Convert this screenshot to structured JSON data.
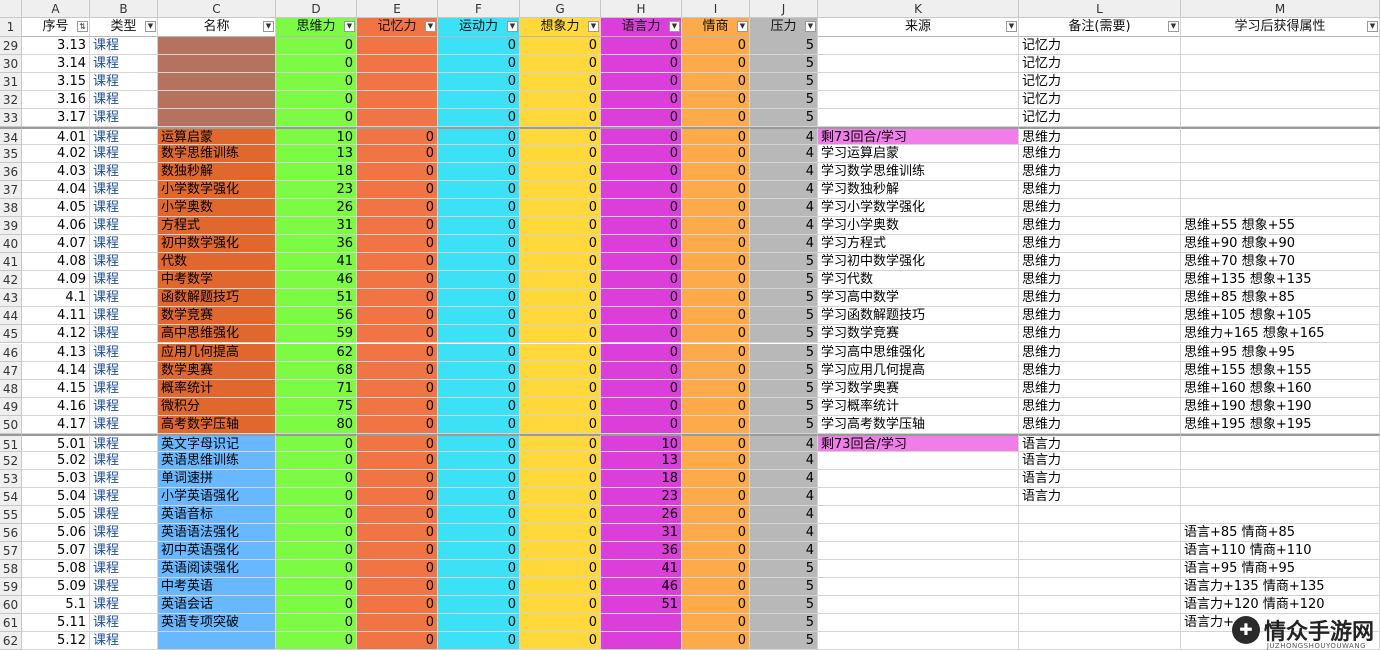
{
  "colors": {
    "name_brown": "#b5735f",
    "name_orange": "#e0682f",
    "name_blue": "#67b8ff",
    "d_green": "#7dfb44",
    "e_orange": "#f07444",
    "f_cyan": "#3de1f5",
    "g_yellow": "#ffd93b",
    "h_magenta": "#dc3fd9",
    "i_orange": "#fdaa4a",
    "j_gray": "#b8b8b8",
    "k_pink": "#f07de8",
    "white": "#ffffff"
  },
  "column_letters": [
    "",
    "A",
    "B",
    "C",
    "D",
    "E",
    "F",
    "G",
    "H",
    "I",
    "J",
    "K",
    "L",
    "M"
  ],
  "headers": [
    "1",
    "序号",
    "类型",
    "名称",
    "思维力",
    "记忆力",
    "运动力",
    "想象力",
    "语言力",
    "情商",
    "压力",
    "来源",
    "备注(需要)",
    "学习后获得属性"
  ],
  "rows": [
    {
      "rn": "29",
      "a": "3.13",
      "b": "课程",
      "c": "",
      "d": "0",
      "e": "",
      "f": "0",
      "g": "0",
      "h": "0",
      "i": "0",
      "j": "5",
      "k": "",
      "l": "记忆力",
      "m": ""
    },
    {
      "rn": "30",
      "a": "3.14",
      "b": "课程",
      "c": "",
      "d": "0",
      "e": "",
      "f": "0",
      "g": "0",
      "h": "0",
      "i": "0",
      "j": "5",
      "k": "",
      "l": "记忆力",
      "m": ""
    },
    {
      "rn": "31",
      "a": "3.15",
      "b": "课程",
      "c": "",
      "d": "0",
      "e": "",
      "f": "0",
      "g": "0",
      "h": "0",
      "i": "0",
      "j": "5",
      "k": "",
      "l": "记忆力",
      "m": ""
    },
    {
      "rn": "32",
      "a": "3.16",
      "b": "课程",
      "c": "",
      "d": "0",
      "e": "",
      "f": "0",
      "g": "0",
      "h": "0",
      "i": "0",
      "j": "5",
      "k": "",
      "l": "记忆力",
      "m": ""
    },
    {
      "rn": "33",
      "a": "3.17",
      "b": "课程",
      "c": "",
      "d": "0",
      "e": "",
      "f": "0",
      "g": "0",
      "h": "0",
      "i": "0",
      "j": "5",
      "k": "",
      "l": "记忆力",
      "m": ""
    },
    {
      "rn": "34",
      "a": "4.01",
      "b": "课程",
      "c": "运算启蒙",
      "d": "10",
      "e": "0",
      "f": "0",
      "g": "0",
      "h": "0",
      "i": "0",
      "j": "4",
      "k": "剩73回合/学习",
      "l": "思维力",
      "m": ""
    },
    {
      "rn": "35",
      "a": "4.02",
      "b": "课程",
      "c": "数学思维训练",
      "d": "13",
      "e": "0",
      "f": "0",
      "g": "0",
      "h": "0",
      "i": "0",
      "j": "4",
      "k": "学习运算启蒙",
      "l": "思维力",
      "m": ""
    },
    {
      "rn": "36",
      "a": "4.03",
      "b": "课程",
      "c": "数独秒解",
      "d": "18",
      "e": "0",
      "f": "0",
      "g": "0",
      "h": "0",
      "i": "0",
      "j": "4",
      "k": "学习数学思维训练",
      "l": "思维力",
      "m": ""
    },
    {
      "rn": "37",
      "a": "4.04",
      "b": "课程",
      "c": "小学数学强化",
      "d": "23",
      "e": "0",
      "f": "0",
      "g": "0",
      "h": "0",
      "i": "0",
      "j": "4",
      "k": "学习数独秒解",
      "l": "思维力",
      "m": ""
    },
    {
      "rn": "38",
      "a": "4.05",
      "b": "课程",
      "c": "小学奥数",
      "d": "26",
      "e": "0",
      "f": "0",
      "g": "0",
      "h": "0",
      "i": "0",
      "j": "4",
      "k": "学习小学数学强化",
      "l": "思维力",
      "m": ""
    },
    {
      "rn": "39",
      "a": "4.06",
      "b": "课程",
      "c": "方程式",
      "d": "31",
      "e": "0",
      "f": "0",
      "g": "0",
      "h": "0",
      "i": "0",
      "j": "4",
      "k": "学习小学奥数",
      "l": "思维力",
      "m": "思维+55 想象+55"
    },
    {
      "rn": "40",
      "a": "4.07",
      "b": "课程",
      "c": "初中数学强化",
      "d": "36",
      "e": "0",
      "f": "0",
      "g": "0",
      "h": "0",
      "i": "0",
      "j": "4",
      "k": "学习方程式",
      "l": "思维力",
      "m": "思维+90 想象+90"
    },
    {
      "rn": "41",
      "a": "4.08",
      "b": "课程",
      "c": "代数",
      "d": "41",
      "e": "0",
      "f": "0",
      "g": "0",
      "h": "0",
      "i": "0",
      "j": "5",
      "k": "学习初中数学强化",
      "l": "思维力",
      "m": "思维+70 想象+70"
    },
    {
      "rn": "42",
      "a": "4.09",
      "b": "课程",
      "c": "中考数学",
      "d": "46",
      "e": "0",
      "f": "0",
      "g": "0",
      "h": "0",
      "i": "0",
      "j": "5",
      "k": "学习代数",
      "l": "思维力",
      "m": "思维+135 想象+135"
    },
    {
      "rn": "43",
      "a": "4.1",
      "b": "课程",
      "c": "函数解题技巧",
      "d": "51",
      "e": "0",
      "f": "0",
      "g": "0",
      "h": "0",
      "i": "0",
      "j": "5",
      "k": "学习高中数学",
      "l": "思维力",
      "m": "思维+85 想象+85"
    },
    {
      "rn": "44",
      "a": "4.11",
      "b": "课程",
      "c": "数学竞赛",
      "d": "56",
      "e": "0",
      "f": "0",
      "g": "0",
      "h": "0",
      "i": "0",
      "j": "5",
      "k": "学习函数解题技巧",
      "l": "思维力",
      "m": "思维+105 想象+105"
    },
    {
      "rn": "45",
      "a": "4.12",
      "b": "课程",
      "c": "高中思维强化",
      "d": "59",
      "e": "0",
      "f": "0",
      "g": "0",
      "h": "0",
      "i": "0",
      "j": "5",
      "k": "学习数学竞赛",
      "l": "思维力",
      "m": "思维力+165 想象+165"
    },
    {
      "rn": "46",
      "a": "4.13",
      "b": "课程",
      "c": "应用几何提高",
      "d": "62",
      "e": "0",
      "f": "0",
      "g": "0",
      "h": "0",
      "i": "0",
      "j": "5",
      "k": "学习高中思维强化",
      "l": "思维力",
      "m": "思维+95 想象+95"
    },
    {
      "rn": "47",
      "a": "4.14",
      "b": "课程",
      "c": "数学奥赛",
      "d": "68",
      "e": "0",
      "f": "0",
      "g": "0",
      "h": "0",
      "i": "0",
      "j": "5",
      "k": "学习应用几何提高",
      "l": "思维力",
      "m": "思维+155 想象+155"
    },
    {
      "rn": "48",
      "a": "4.15",
      "b": "课程",
      "c": "概率统计",
      "d": "71",
      "e": "0",
      "f": "0",
      "g": "0",
      "h": "0",
      "i": "0",
      "j": "5",
      "k": "学习数学奥赛",
      "l": "思维力",
      "m": "思维+160 想象+160"
    },
    {
      "rn": "49",
      "a": "4.16",
      "b": "课程",
      "c": "微积分",
      "d": "75",
      "e": "0",
      "f": "0",
      "g": "0",
      "h": "0",
      "i": "0",
      "j": "5",
      "k": "学习概率统计",
      "l": "思维力",
      "m": "思维+190 想象+190"
    },
    {
      "rn": "50",
      "a": "4.17",
      "b": "课程",
      "c": "高考数学压轴",
      "d": "80",
      "e": "0",
      "f": "0",
      "g": "0",
      "h": "0",
      "i": "0",
      "j": "5",
      "k": "学习高考数学压轴",
      "l": "思维力",
      "m": "思维+195 想象+195"
    },
    {
      "rn": "51",
      "a": "5.01",
      "b": "课程",
      "c": "英文字母识记",
      "d": "0",
      "e": "0",
      "f": "0",
      "g": "0",
      "h": "10",
      "i": "0",
      "j": "4",
      "k": "剩73回合/学习",
      "l": "语言力",
      "m": ""
    },
    {
      "rn": "52",
      "a": "5.02",
      "b": "课程",
      "c": "英语思维训练",
      "d": "0",
      "e": "0",
      "f": "0",
      "g": "0",
      "h": "13",
      "i": "0",
      "j": "4",
      "k": "",
      "l": "语言力",
      "m": ""
    },
    {
      "rn": "53",
      "a": "5.03",
      "b": "课程",
      "c": "单词速拼",
      "d": "0",
      "e": "0",
      "f": "0",
      "g": "0",
      "h": "18",
      "i": "0",
      "j": "4",
      "k": "",
      "l": "语言力",
      "m": ""
    },
    {
      "rn": "54",
      "a": "5.04",
      "b": "课程",
      "c": "小学英语强化",
      "d": "0",
      "e": "0",
      "f": "0",
      "g": "0",
      "h": "23",
      "i": "0",
      "j": "4",
      "k": "",
      "l": "语言力",
      "m": ""
    },
    {
      "rn": "55",
      "a": "5.05",
      "b": "课程",
      "c": "英语音标",
      "d": "0",
      "e": "0",
      "f": "0",
      "g": "0",
      "h": "26",
      "i": "0",
      "j": "4",
      "k": "",
      "l": "",
      "m": ""
    },
    {
      "rn": "56",
      "a": "5.06",
      "b": "课程",
      "c": "英语语法强化",
      "d": "0",
      "e": "0",
      "f": "0",
      "g": "0",
      "h": "31",
      "i": "0",
      "j": "4",
      "k": "",
      "l": "",
      "m": "语言+85 情商+85"
    },
    {
      "rn": "57",
      "a": "5.07",
      "b": "课程",
      "c": "初中英语强化",
      "d": "0",
      "e": "0",
      "f": "0",
      "g": "0",
      "h": "36",
      "i": "0",
      "j": "4",
      "k": "",
      "l": "",
      "m": "语言+110 情商+110"
    },
    {
      "rn": "58",
      "a": "5.08",
      "b": "课程",
      "c": "英语阅读强化",
      "d": "0",
      "e": "0",
      "f": "0",
      "g": "0",
      "h": "41",
      "i": "0",
      "j": "5",
      "k": "",
      "l": "",
      "m": "语言+95 情商+95"
    },
    {
      "rn": "59",
      "a": "5.09",
      "b": "课程",
      "c": "中考英语",
      "d": "0",
      "e": "0",
      "f": "0",
      "g": "0",
      "h": "46",
      "i": "0",
      "j": "5",
      "k": "",
      "l": "",
      "m": "语言力+135 情商+135"
    },
    {
      "rn": "60",
      "a": "5.1",
      "b": "课程",
      "c": "英语会话",
      "d": "0",
      "e": "0",
      "f": "0",
      "g": "0",
      "h": "51",
      "i": "0",
      "j": "5",
      "k": "",
      "l": "",
      "m": "语言力+120 情商+120"
    },
    {
      "rn": "61",
      "a": "5.11",
      "b": "课程",
      "c": "英语专项突破",
      "d": "0",
      "e": "0",
      "f": "0",
      "g": "0",
      "h": "",
      "i": "0",
      "j": "5",
      "k": "",
      "l": "",
      "m": "语言力+"
    },
    {
      "rn": "62",
      "a": "5.12",
      "b": "课程",
      "c": "",
      "d": "0",
      "e": "0",
      "f": "0",
      "g": "0",
      "h": "",
      "i": "0",
      "j": "5",
      "k": "",
      "l": "",
      "m": ""
    }
  ],
  "watermark": {
    "text": "情众手游网",
    "sub": "JUZHONGSHOUYOUWANG",
    "icon": "✚"
  }
}
